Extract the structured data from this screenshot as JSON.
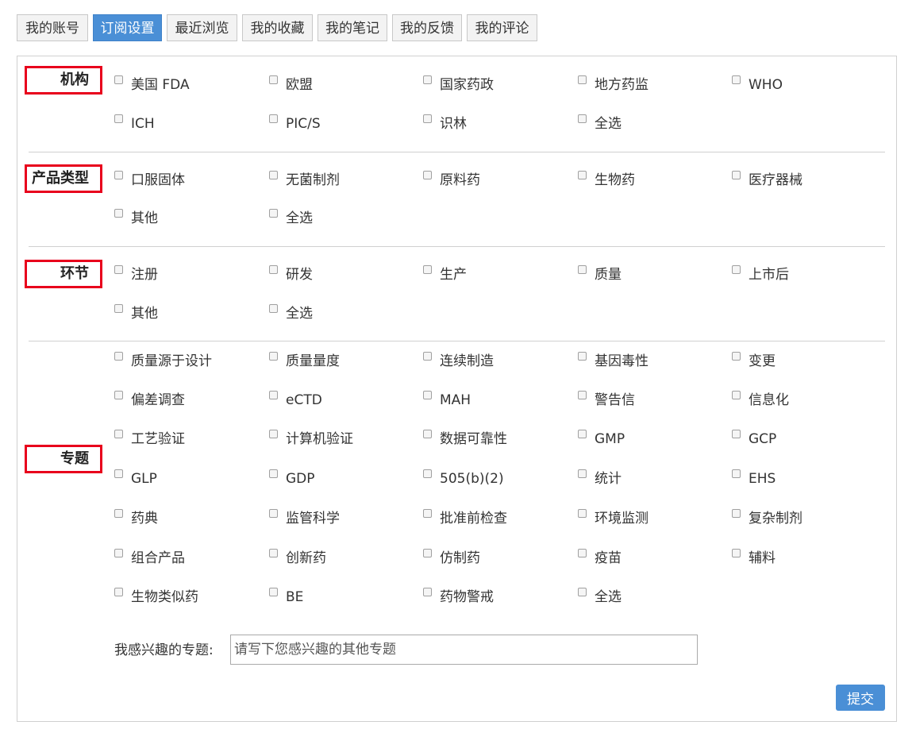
{
  "tabs": [
    {
      "label": "我的账号",
      "active": false
    },
    {
      "label": "订阅设置",
      "active": true
    },
    {
      "label": "最近浏览",
      "active": false
    },
    {
      "label": "我的收藏",
      "active": false
    },
    {
      "label": "我的笔记",
      "active": false
    },
    {
      "label": "我的反馈",
      "active": false
    },
    {
      "label": "我的评论",
      "active": false
    }
  ],
  "sections": {
    "agency": {
      "label": "机构",
      "options": [
        "美国 FDA",
        "欧盟",
        "国家药政",
        "地方药监",
        "WHO",
        "ICH",
        "PIC/S",
        "识林",
        "全选"
      ]
    },
    "product_type": {
      "label": "产品类型",
      "options": [
        "口服固体",
        "无菌制剂",
        "原料药",
        "生物药",
        "医疗器械",
        "其他",
        "全选"
      ]
    },
    "stage": {
      "label": "环节",
      "options": [
        "注册",
        "研发",
        "生产",
        "质量",
        "上市后",
        "其他",
        "全选"
      ]
    },
    "topic": {
      "label": "专题",
      "options": [
        "质量源于设计",
        "质量量度",
        "连续制造",
        "基因毒性",
        "变更",
        "偏差调查",
        "eCTD",
        "MAH",
        "警告信",
        "信息化",
        "工艺验证",
        "计算机验证",
        "数据可靠性",
        "GMP",
        "GCP",
        "GLP",
        "GDP",
        "505(b)(2)",
        "统计",
        "EHS",
        "药典",
        "监管科学",
        "批准前检查",
        "环境监测",
        "复杂制剂",
        "组合产品",
        "创新药",
        "仿制药",
        "疫苗",
        "辅料",
        "生物类似药",
        "BE",
        "药物警戒",
        "全选"
      ]
    }
  },
  "interest": {
    "label": "我感兴趣的专题:",
    "placeholder": "请写下您感兴趣的其他专题"
  },
  "submit_label": "提交",
  "colors": {
    "accent": "#4a8fd6",
    "label_border": "#e8001c"
  }
}
